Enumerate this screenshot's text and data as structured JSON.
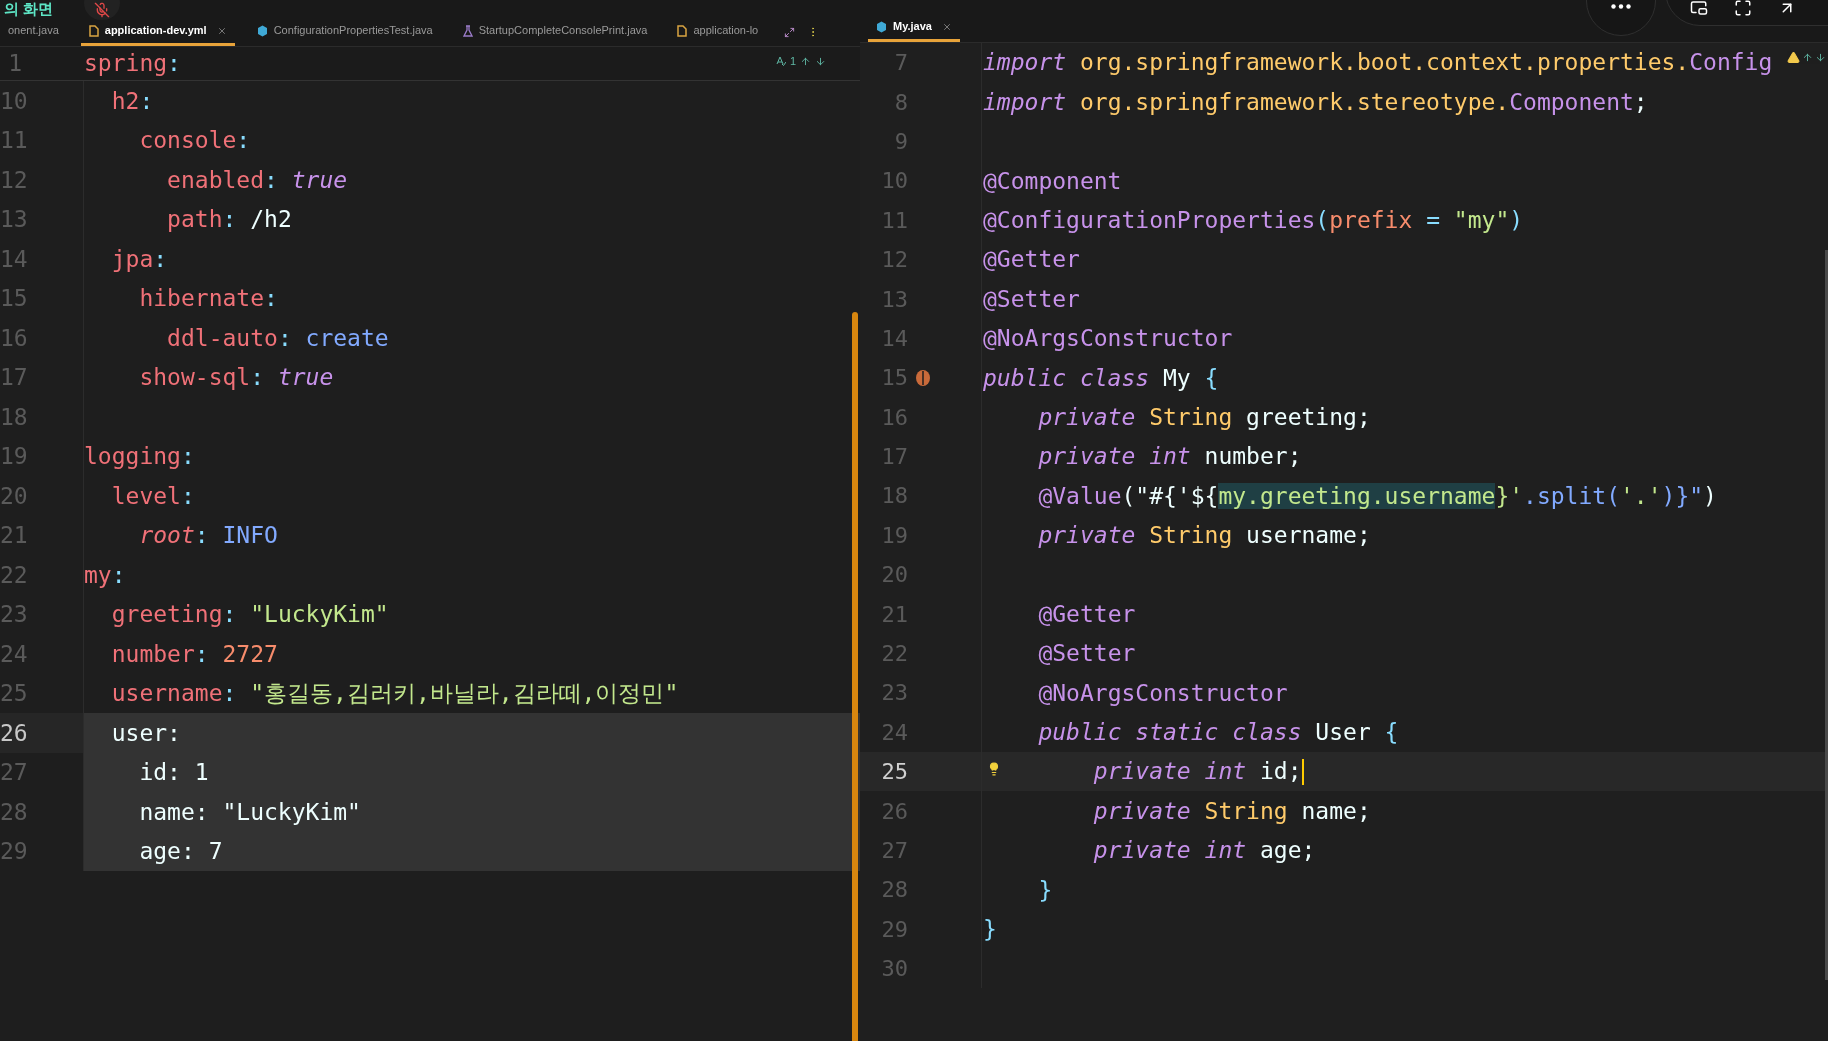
{
  "overlay": {
    "caption": "의 화면"
  },
  "left": {
    "focused": false,
    "tabs": [
      {
        "label": "onent.java",
        "kind": "plain",
        "selected": false,
        "closable": false
      },
      {
        "label": "application-dev.yml",
        "kind": "yaml",
        "selected": true,
        "closable": true
      },
      {
        "label": "ConfigurationPropertiesTest.java",
        "kind": "java",
        "selected": false,
        "closable": false
      },
      {
        "label": "StartupCompleteConsolePrint.java",
        "kind": "java_run",
        "selected": false,
        "closable": false
      },
      {
        "label": "application-lo",
        "kind": "yaml",
        "selected": false,
        "closable": false
      }
    ],
    "inspection_count": "1",
    "sticky_line": {
      "number": "1",
      "tokens": [
        {
          "kind": "key",
          "text": "spring"
        },
        {
          "kind": "punct",
          "text": ":"
        }
      ]
    },
    "lines": [
      {
        "number": "10",
        "current": false,
        "selected": false,
        "tokens": [
          {
            "kind": "key",
            "text": "  h2"
          },
          {
            "kind": "punct",
            "text": ":"
          }
        ]
      },
      {
        "number": "11",
        "current": false,
        "selected": false,
        "tokens": [
          {
            "kind": "key",
            "text": "    console"
          },
          {
            "kind": "punct",
            "text": ":"
          }
        ]
      },
      {
        "number": "12",
        "current": false,
        "selected": false,
        "tokens": [
          {
            "kind": "key",
            "text": "      enabled"
          },
          {
            "kind": "punct",
            "text": ": "
          },
          {
            "kind": "bool",
            "text": "true"
          }
        ]
      },
      {
        "number": "13",
        "current": false,
        "selected": false,
        "tokens": [
          {
            "kind": "key",
            "text": "      path"
          },
          {
            "kind": "punct",
            "text": ": "
          },
          {
            "kind": "plain",
            "text": "/h2"
          }
        ]
      },
      {
        "number": "14",
        "current": false,
        "selected": false,
        "tokens": [
          {
            "kind": "key",
            "text": "  jpa"
          },
          {
            "kind": "punct",
            "text": ":"
          }
        ]
      },
      {
        "number": "15",
        "current": false,
        "selected": false,
        "tokens": [
          {
            "kind": "key",
            "text": "    hibernate"
          },
          {
            "kind": "punct",
            "text": ":"
          }
        ]
      },
      {
        "number": "16",
        "current": false,
        "selected": false,
        "tokens": [
          {
            "kind": "key",
            "text": "      ddl-auto"
          },
          {
            "kind": "punct",
            "text": ": "
          },
          {
            "kind": "enum",
            "text": "create"
          }
        ]
      },
      {
        "number": "17",
        "current": false,
        "selected": false,
        "tokens": [
          {
            "kind": "key",
            "text": "    show-sql"
          },
          {
            "kind": "punct",
            "text": ": "
          },
          {
            "kind": "bool",
            "text": "true"
          }
        ]
      },
      {
        "number": "18",
        "current": false,
        "selected": false
      },
      {
        "number": "19",
        "current": false,
        "selected": false,
        "tokens": [
          {
            "kind": "key",
            "text": "logging"
          },
          {
            "kind": "punct",
            "text": ":"
          }
        ]
      },
      {
        "number": "20",
        "current": false,
        "selected": false,
        "tokens": [
          {
            "kind": "key",
            "text": "  level"
          },
          {
            "kind": "punct",
            "text": ":"
          }
        ]
      },
      {
        "number": "21",
        "current": false,
        "selected": false,
        "tokens": [
          {
            "kind": "key_italic",
            "text": "    root"
          },
          {
            "kind": "punct",
            "text": ": "
          },
          {
            "kind": "enum",
            "text": "INFO"
          }
        ]
      },
      {
        "number": "22",
        "current": false,
        "selected": false,
        "tokens": [
          {
            "kind": "key",
            "text": "my"
          },
          {
            "kind": "punct",
            "text": ":"
          }
        ]
      },
      {
        "number": "23",
        "current": false,
        "selected": false,
        "tokens": [
          {
            "kind": "key",
            "text": "  greeting"
          },
          {
            "kind": "punct",
            "text": ": "
          },
          {
            "kind": "str",
            "text": "\"LuckyKim\""
          }
        ]
      },
      {
        "number": "24",
        "current": false,
        "selected": false,
        "tokens": [
          {
            "kind": "key",
            "text": "  number"
          },
          {
            "kind": "punct",
            "text": ": "
          },
          {
            "kind": "num",
            "text": "2727"
          }
        ]
      },
      {
        "number": "25",
        "current": false,
        "selected": false,
        "tokens": [
          {
            "kind": "key",
            "text": "  username"
          },
          {
            "kind": "punct",
            "text": ": "
          },
          {
            "kind": "str",
            "text": "\"홍길동,김러키,바닐라,김라떼,이정민\""
          }
        ]
      },
      {
        "number": "26",
        "current": true,
        "selected": true,
        "tokens": [
          {
            "kind": "plain",
            "text": "  user:"
          }
        ]
      },
      {
        "number": "27",
        "current": false,
        "selected": true,
        "tokens": [
          {
            "kind": "plain",
            "text": "    id: 1"
          }
        ]
      },
      {
        "number": "28",
        "current": false,
        "selected": true,
        "tokens": [
          {
            "kind": "plain",
            "text": "    name: \"LuckyKim\""
          }
        ]
      },
      {
        "number": "29",
        "current": false,
        "selected": true,
        "tokens": [
          {
            "kind": "plain",
            "text": "    age: 7"
          }
        ]
      }
    ]
  },
  "right": {
    "focused": true,
    "tabs": [
      {
        "label": "My.java",
        "kind": "java",
        "selected": true,
        "closable": true
      }
    ],
    "lines": [
      {
        "number": "7",
        "current": false,
        "tokens": [
          {
            "kind": "kw",
            "text": "import"
          },
          {
            "kind": "pkg",
            "text": " org.springframework.boot.context.properties."
          },
          {
            "kind": "cls",
            "text": "Config"
          }
        ]
      },
      {
        "number": "8",
        "current": false,
        "tokens": [
          {
            "kind": "kw",
            "text": "import"
          },
          {
            "kind": "pkg",
            "text": " org.springframework.stereotype."
          },
          {
            "kind": "cls",
            "text": "Component"
          },
          {
            "kind": "ident",
            "text": ";"
          }
        ]
      },
      {
        "number": "9",
        "current": false
      },
      {
        "number": "10",
        "current": false,
        "tokens": [
          {
            "kind": "ann",
            "text": "@Component"
          }
        ]
      },
      {
        "number": "11",
        "current": false,
        "tokens": [
          {
            "kind": "ann",
            "text": "@ConfigurationProperties"
          },
          {
            "kind": "punct",
            "text": "("
          },
          {
            "kind": "param",
            "text": "prefix"
          },
          {
            "kind": "punct",
            "text": " = "
          },
          {
            "kind": "str",
            "text": "\"my\""
          },
          {
            "kind": "punct",
            "text": ")"
          }
        ]
      },
      {
        "number": "12",
        "current": false,
        "tokens": [
          {
            "kind": "ann",
            "text": "@Getter"
          }
        ]
      },
      {
        "number": "13",
        "current": false,
        "tokens": [
          {
            "kind": "ann",
            "text": "@Setter"
          }
        ]
      },
      {
        "number": "14",
        "current": false,
        "tokens": [
          {
            "kind": "ann",
            "text": "@NoArgsConstructor"
          }
        ]
      },
      {
        "number": "15",
        "current": false,
        "kind": "bean",
        "tokens": [
          {
            "kind": "kw",
            "text": "public class"
          },
          {
            "kind": "ident",
            "text": " My "
          },
          {
            "kind": "punct",
            "text": "{"
          }
        ]
      },
      {
        "number": "16",
        "current": false,
        "tokens": [
          {
            "kind": "kw",
            "text": "    private"
          },
          {
            "kind": "type",
            "text": " String"
          },
          {
            "kind": "ident",
            "text": " greeting;"
          }
        ]
      },
      {
        "number": "17",
        "current": false,
        "tokens": [
          {
            "kind": "kw",
            "text": "    private int"
          },
          {
            "kind": "ident",
            "text": " number;"
          }
        ]
      },
      {
        "number": "18",
        "current": false,
        "tokens": [
          {
            "kind": "ann",
            "text": "    @Value"
          },
          {
            "kind": "ident",
            "text": "(\"#{'${"
          },
          {
            "kind": "match",
            "text": "my.greeting.username"
          },
          {
            "kind": "str",
            "text": "}'"
          },
          {
            "kind": "fn",
            "text": ".split("
          },
          {
            "kind": "str",
            "text": "'.'"
          },
          {
            "kind": "fn",
            "text": ")}\""
          },
          {
            "kind": "ident",
            "text": ")"
          }
        ]
      },
      {
        "number": "19",
        "current": false,
        "tokens": [
          {
            "kind": "kw",
            "text": "    private"
          },
          {
            "kind": "type",
            "text": " String"
          },
          {
            "kind": "ident",
            "text": " username;"
          }
        ]
      },
      {
        "number": "20",
        "current": false
      },
      {
        "number": "21",
        "current": false,
        "tokens": [
          {
            "kind": "ann",
            "text": "    @Getter"
          }
        ]
      },
      {
        "number": "22",
        "current": false,
        "tokens": [
          {
            "kind": "ann",
            "text": "    @Setter"
          }
        ]
      },
      {
        "number": "23",
        "current": false,
        "tokens": [
          {
            "kind": "ann",
            "text": "    @NoArgsConstructor"
          }
        ]
      },
      {
        "number": "24",
        "current": false,
        "tokens": [
          {
            "kind": "kw",
            "text": "    public static class"
          },
          {
            "kind": "ident",
            "text": " User "
          },
          {
            "kind": "punct",
            "text": "{"
          }
        ]
      },
      {
        "number": "25",
        "current": true,
        "kind": "bulb",
        "tokens": [
          {
            "kind": "kw",
            "text": "        private int"
          },
          {
            "kind": "ident",
            "text": " id;"
          }
        ]
      },
      {
        "number": "26",
        "current": false,
        "tokens": [
          {
            "kind": "kw",
            "text": "        private"
          },
          {
            "kind": "type",
            "text": " String"
          },
          {
            "kind": "ident",
            "text": " name;"
          }
        ]
      },
      {
        "number": "27",
        "current": false,
        "tokens": [
          {
            "kind": "kw",
            "text": "        private int"
          },
          {
            "kind": "ident",
            "text": " age;"
          }
        ]
      },
      {
        "number": "28",
        "current": false,
        "tokens": [
          {
            "kind": "punct",
            "text": "    }"
          }
        ]
      },
      {
        "number": "29",
        "current": false,
        "tokens": [
          {
            "kind": "punct",
            "text": "}"
          }
        ]
      },
      {
        "number": "30",
        "current": false
      }
    ]
  }
}
